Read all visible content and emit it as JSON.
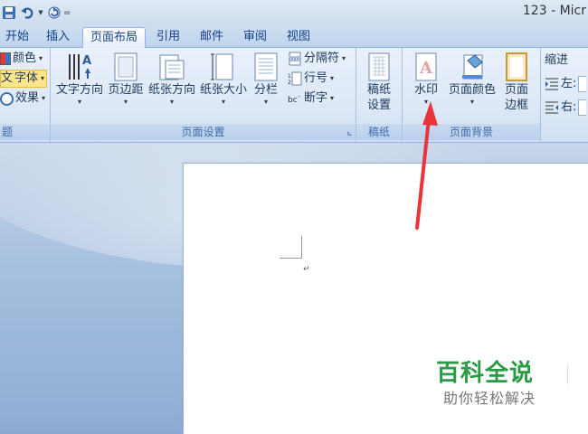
{
  "window": {
    "title": "123 - Micr"
  },
  "qat": {
    "separator": "="
  },
  "tabs": [
    {
      "label": "开始"
    },
    {
      "label": "插入"
    },
    {
      "label": "页面布局",
      "active": true
    },
    {
      "label": "引用"
    },
    {
      "label": "邮件"
    },
    {
      "label": "审阅"
    },
    {
      "label": "视图"
    }
  ],
  "theme_group": {
    "colors": "颜色",
    "fonts": "字体",
    "effects": "效果",
    "label": "题",
    "font_icon_glyph": "文"
  },
  "page_setup": {
    "text_direction": "文字方向",
    "margins": "页边距",
    "orientation": "纸张方向",
    "size": "纸张大小",
    "columns": "分栏",
    "breaks": "分隔符",
    "line_numbers": "行号",
    "hyphenation": "断字",
    "label": "页面设置",
    "launcher": "⊾"
  },
  "draft": {
    "settings_line1": "稿纸",
    "settings_line2": "设置",
    "label": "稿纸"
  },
  "page_background": {
    "watermark": "水印",
    "page_color": "页面颜色",
    "border_line1": "页面",
    "border_line2": "边框",
    "label": "页面背景"
  },
  "paragraph": {
    "indent": "缩进",
    "left": "左:",
    "right": "右:"
  },
  "watermark_site": {
    "name": "百科全说",
    "slogan": "助你轻松解决"
  },
  "colors": {
    "annotation_arrow": "#e8353a",
    "watermark_green": "#2a9a44"
  }
}
